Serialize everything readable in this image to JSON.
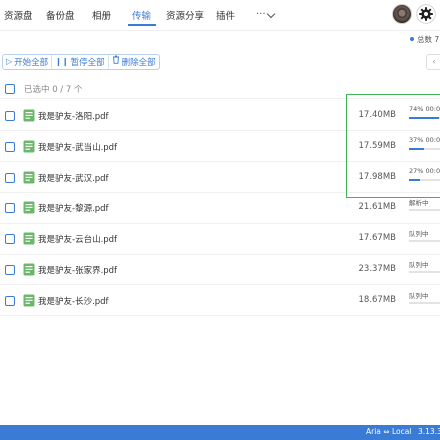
{
  "nav": {
    "tabs": [
      {
        "label": "资源盘"
      },
      {
        "label": "备份盘"
      },
      {
        "label": "相册"
      },
      {
        "label": "传输"
      },
      {
        "label": "资源分享"
      },
      {
        "label": "插件"
      }
    ],
    "more": "...",
    "active_tab": "传输"
  },
  "toolbar": {
    "total_label": "总数 7",
    "start_all": "开始全部",
    "pause_all": "暂停全部",
    "delete_all": "删除全部"
  },
  "list": {
    "selected_text": "已选中 0 / 7 个",
    "files": [
      {
        "name": "我是驴友-洛阳.pdf",
        "size": "17.40MB",
        "status": "74% 00:00",
        "progress": 0.74
      },
      {
        "name": "我是驴友-武当山.pdf",
        "size": "17.59MB",
        "status": "37% 00:00",
        "progress": 0.37
      },
      {
        "name": "我是驴友-武汉.pdf",
        "size": "17.98MB",
        "status": "27% 00:00",
        "progress": 0.27
      },
      {
        "name": "我是驴友-黎源.pdf",
        "size": "21.61MB",
        "status": "解析中",
        "progress": 0
      },
      {
        "name": "我是驴友-云台山.pdf",
        "size": "17.67MB",
        "status": "队列中",
        "progress": 0
      },
      {
        "name": "我是驴友-张家界.pdf",
        "size": "23.37MB",
        "status": "队列中",
        "progress": 0
      },
      {
        "name": "我是驴友-长沙.pdf",
        "size": "18.67MB",
        "status": "队列中",
        "progress": 0
      }
    ]
  },
  "footer": {
    "engine": "Aria ⇔ Local",
    "version": "3.13.3"
  },
  "colors": {
    "accent": "#3a7bd5",
    "highlight": "#43b35a",
    "pdf_icon": "#6bb86a"
  },
  "icons": {
    "avatar": "user-avatar",
    "settings": "gear-icon",
    "start": "play-icon",
    "pause": "pause-icon",
    "delete": "trash-icon",
    "file": "pdf-file-icon"
  }
}
